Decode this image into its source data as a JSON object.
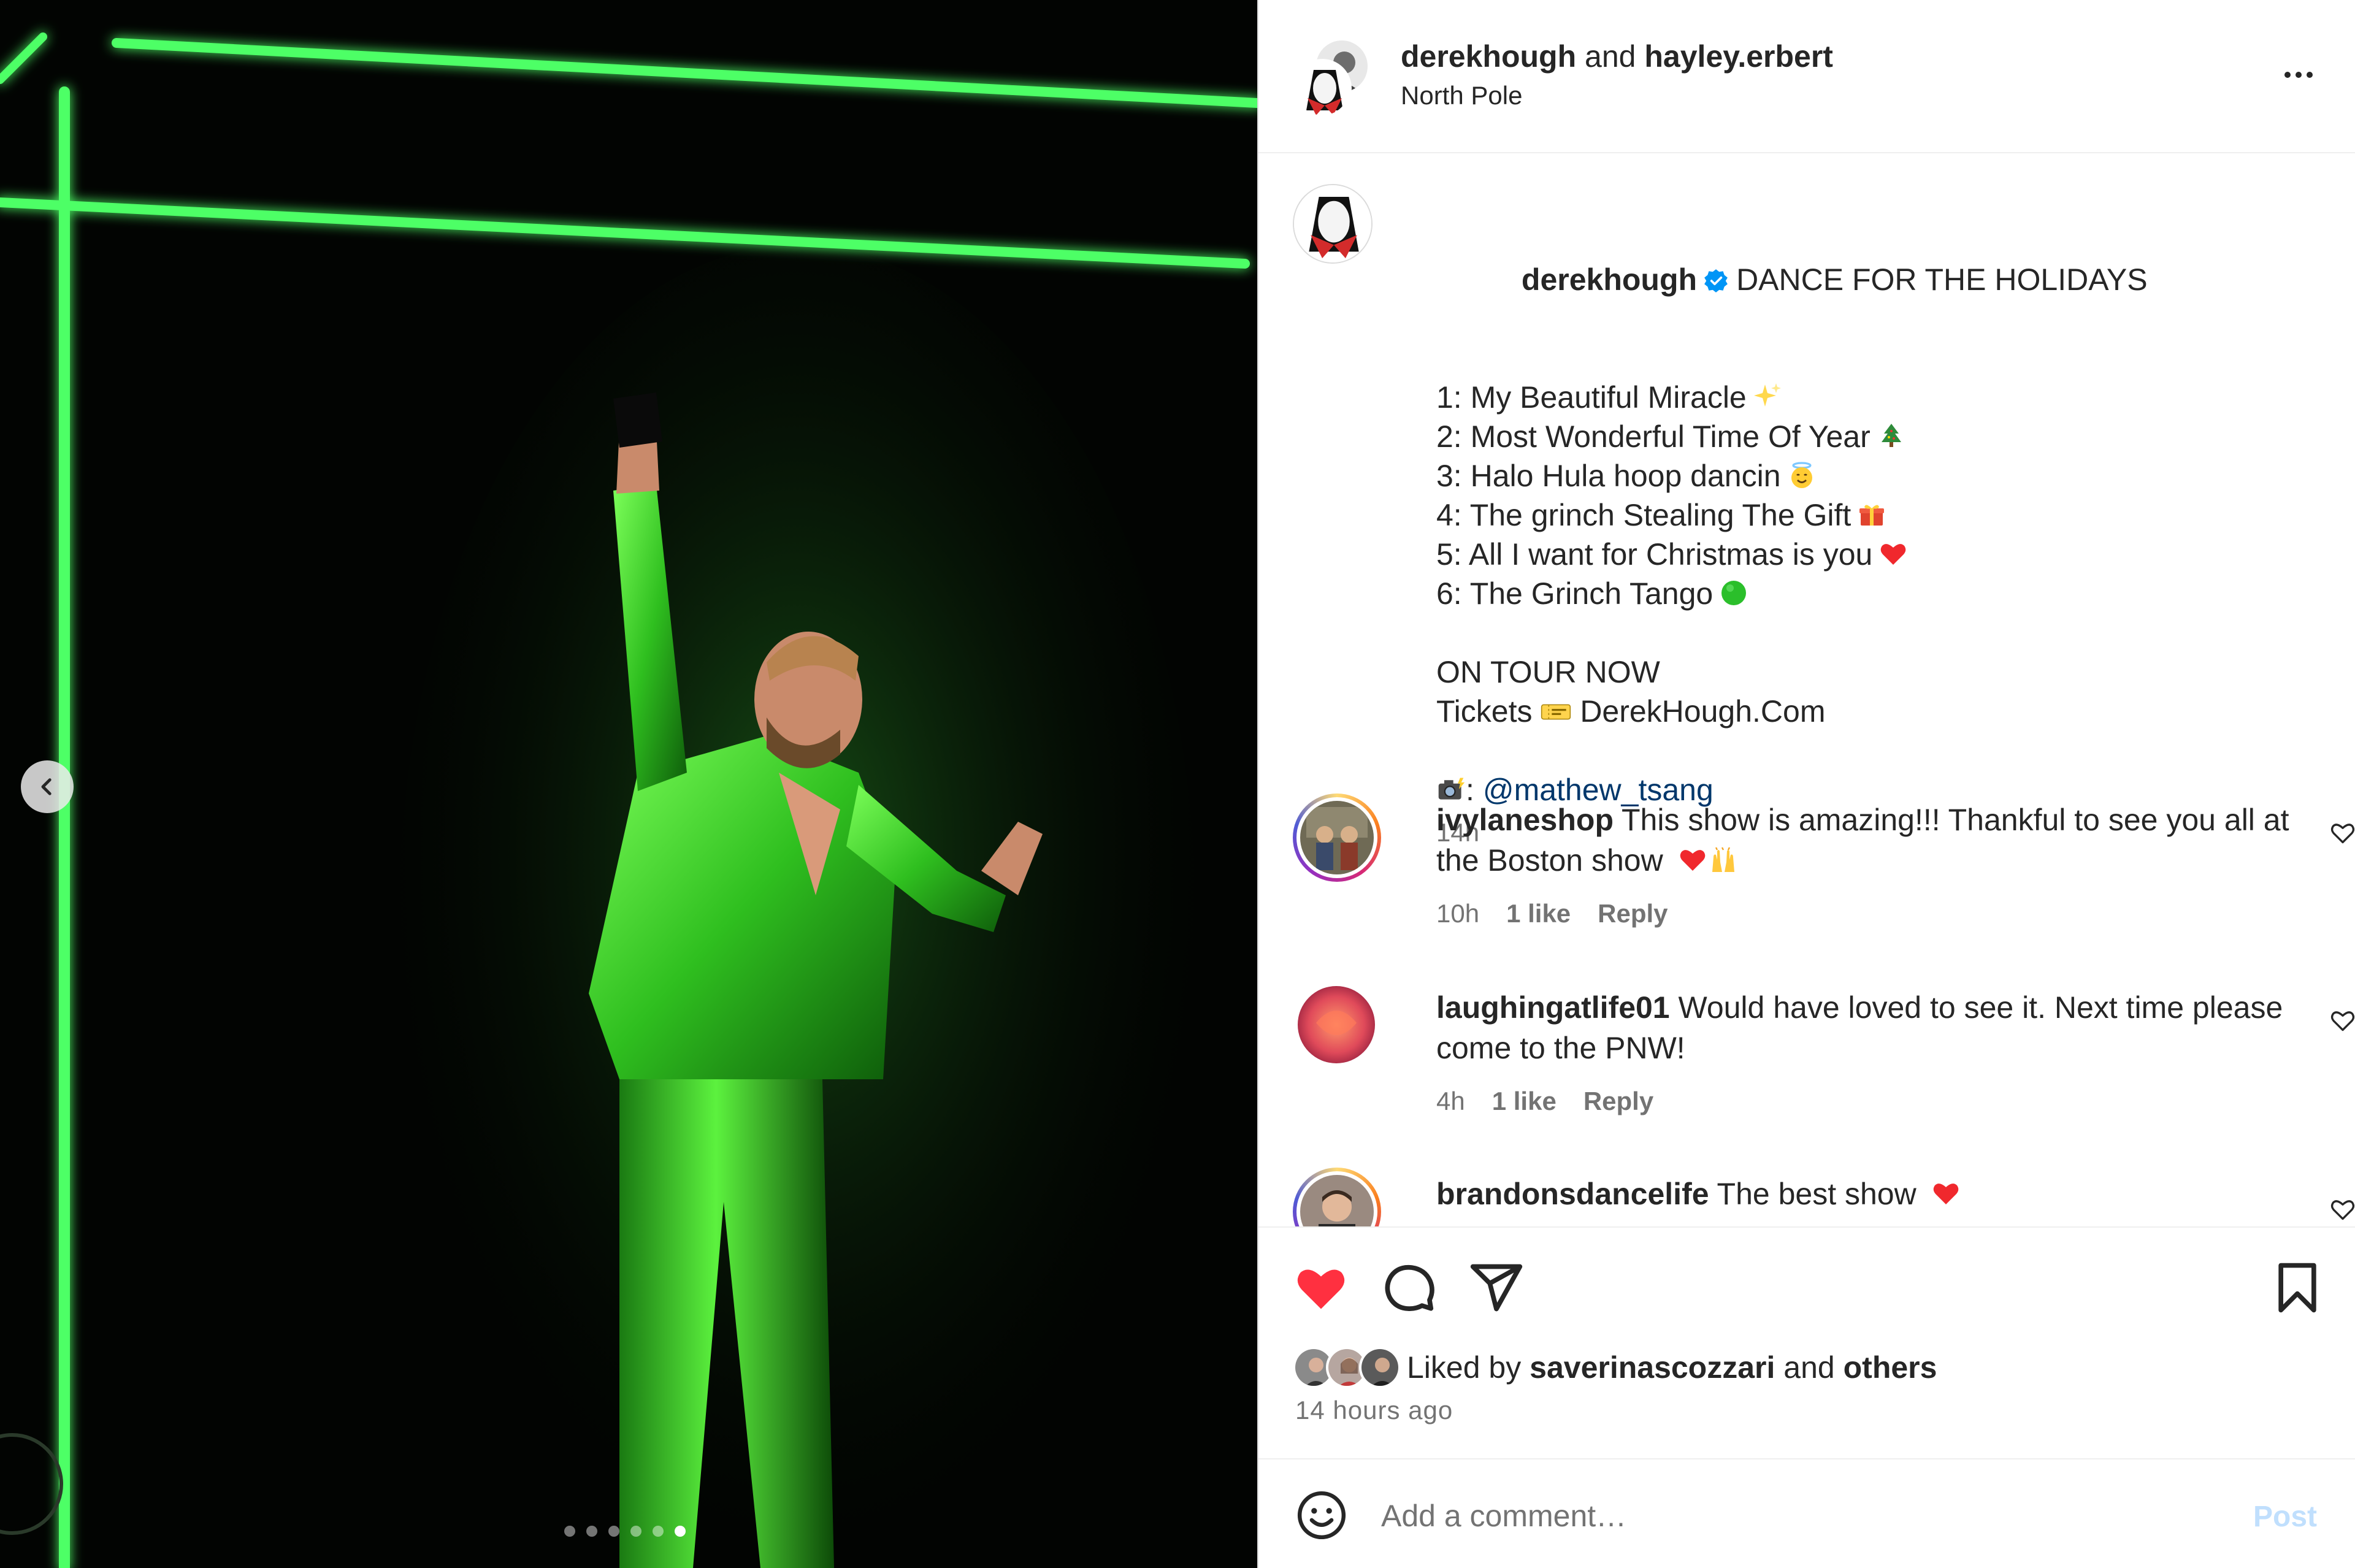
{
  "post_header": {
    "user1": "derekhough",
    "and_text": "and",
    "user2": "hayley.erbert",
    "location": "North Pole"
  },
  "caption": {
    "username": "derekhough",
    "verified": true,
    "headline": "DANCE FOR THE HOLIDAYS",
    "lines": [
      "1: My Beautiful Miracle",
      "2: Most Wonderful Time Of Year",
      "3: Halo Hula hoop dancin",
      "4: The grinch Stealing The Gift",
      "5: All I want for Christmas is you",
      "6: The Grinch Tango"
    ],
    "line_emojis": [
      "sparkles-emoji",
      "christmas-tree-emoji",
      "halo-face-emoji",
      "gift-emoji",
      "red-heart-emoji",
      "green-circle-emoji"
    ],
    "tour": "ON TOUR NOW",
    "tickets_label": "Tickets",
    "tickets_site": "DerekHough.Com",
    "credit_sep": ":",
    "credit_mention": "@mathew_tsang",
    "time": "14h"
  },
  "comments": [
    {
      "username": "ivylaneshop",
      "text": "This show is amazing!!! Thankful to see you all at the Boston show",
      "emojis": "red-heart, raised-hands",
      "time": "10h",
      "likes": "1 like",
      "reply": "Reply",
      "story_ring": true
    },
    {
      "username": "laughingatlife01",
      "text": "Would have loved to see it. Next time please come to the PNW!",
      "time": "4h",
      "likes": "1 like",
      "reply": "Reply",
      "story_ring": false
    },
    {
      "username": "brandonsdancelife",
      "text": "The best show",
      "emojis": "red-heart",
      "story_ring": true
    }
  ],
  "actions": {
    "liked": true,
    "like_color": "#ff3040"
  },
  "likes": {
    "prefix": "Liked by",
    "user": "saverinascozzari",
    "and_text": "and",
    "others": "others",
    "ago": "14 hours ago"
  },
  "add_comment": {
    "placeholder": "Add a comment…",
    "post_label": "Post"
  },
  "media": {
    "slide_count": 6,
    "active_slide": 6,
    "accent_color": "#39ff6a"
  }
}
